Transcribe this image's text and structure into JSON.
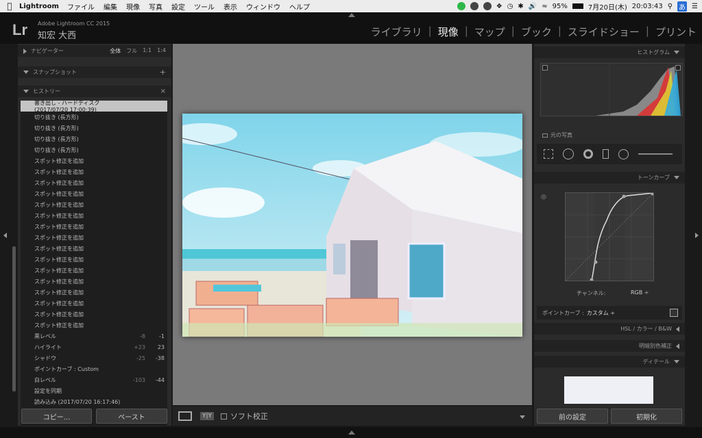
{
  "menubar": {
    "app": "Lightroom",
    "items": [
      "ファイル",
      "編集",
      "現像",
      "写真",
      "設定",
      "ツール",
      "表示",
      "ウィンドウ",
      "ヘルプ"
    ],
    "battery": "95%",
    "date": "7月20日(木)",
    "time": "20:03:43",
    "ime": "あ"
  },
  "header": {
    "logo": "Lr",
    "product": "Adobe Lightroom CC 2015",
    "user": "知宏 大西",
    "modules": [
      "ライブラリ",
      "現像",
      "マップ",
      "ブック",
      "スライドショー",
      "プリント"
    ],
    "active_module": "現像",
    "separator": "|"
  },
  "left": {
    "navigator": {
      "title": "ナビゲーター",
      "zoom": [
        "全体",
        "フル",
        "1:1",
        "1:4"
      ]
    },
    "snapshot": {
      "title": "スナップショット",
      "add": "+"
    },
    "history": {
      "title": "ヒストリー",
      "close": "×",
      "rows": [
        {
          "label": "書き出し - ハードディスク (2017/07/20 17:00:39)",
          "v1": "",
          "v2": ""
        },
        {
          "label": "切り抜き (長方形)",
          "v1": "",
          "v2": ""
        },
        {
          "label": "切り抜き (長方形)",
          "v1": "",
          "v2": ""
        },
        {
          "label": "切り抜き (長方形)",
          "v1": "",
          "v2": ""
        },
        {
          "label": "切り抜き (長方形)",
          "v1": "",
          "v2": ""
        },
        {
          "label": "スポット修正を追加",
          "v1": "",
          "v2": ""
        },
        {
          "label": "スポット修正を追加",
          "v1": "",
          "v2": ""
        },
        {
          "label": "スポット修正を追加",
          "v1": "",
          "v2": ""
        },
        {
          "label": "スポット修正を追加",
          "v1": "",
          "v2": ""
        },
        {
          "label": "スポット修正を追加",
          "v1": "",
          "v2": ""
        },
        {
          "label": "スポット修正を追加",
          "v1": "",
          "v2": ""
        },
        {
          "label": "スポット修正を追加",
          "v1": "",
          "v2": ""
        },
        {
          "label": "スポット修正を追加",
          "v1": "",
          "v2": ""
        },
        {
          "label": "スポット修正を追加",
          "v1": "",
          "v2": ""
        },
        {
          "label": "スポット修正を追加",
          "v1": "",
          "v2": ""
        },
        {
          "label": "スポット修正を追加",
          "v1": "",
          "v2": ""
        },
        {
          "label": "スポット修正を追加",
          "v1": "",
          "v2": ""
        },
        {
          "label": "スポット修正を追加",
          "v1": "",
          "v2": ""
        },
        {
          "label": "スポット修正を追加",
          "v1": "",
          "v2": ""
        },
        {
          "label": "スポット修正を追加",
          "v1": "",
          "v2": ""
        },
        {
          "label": "スポット修正を追加",
          "v1": "",
          "v2": ""
        },
        {
          "label": "黒レベル",
          "v1": "-8",
          "v2": "-1"
        },
        {
          "label": "ハイライト",
          "v1": "+23",
          "v2": "23"
        },
        {
          "label": "シャドウ",
          "v1": "-25",
          "v2": "-38"
        },
        {
          "label": "ポイントカーブ : Custom",
          "v1": "",
          "v2": ""
        },
        {
          "label": "白レベル",
          "v1": "-103",
          "v2": "-44"
        },
        {
          "label": "設定を同期",
          "v1": "",
          "v2": ""
        },
        {
          "label": "読み込み (2017/07/20 16:17:46)",
          "v1": "",
          "v2": ""
        }
      ]
    },
    "copy_button": "コピー...",
    "paste_button": "ペースト"
  },
  "toolbar": {
    "softproof": "ソフト校正",
    "yy": "Y|Y"
  },
  "right": {
    "histogram": {
      "title": "ヒストグラム",
      "original": "元の写真"
    },
    "tonecurve": {
      "title": "トーンカーブ",
      "channel_label": "チャンネル:",
      "channel_value": "RGB ÷",
      "pointcurve_label": "ポイントカーブ :",
      "pointcurve_value": "カスタム ÷"
    },
    "hsl": {
      "title": "HSL / カラー / B&W"
    },
    "splittone": {
      "title": "明暗別色補正"
    },
    "detail": {
      "title": "ディテール"
    },
    "prev_button": "前の設定",
    "reset_button": "初期化"
  },
  "colors": {
    "panel": "#2b2b2b",
    "sel": "#c4c4c4",
    "canvas": "#7a7a7a"
  }
}
